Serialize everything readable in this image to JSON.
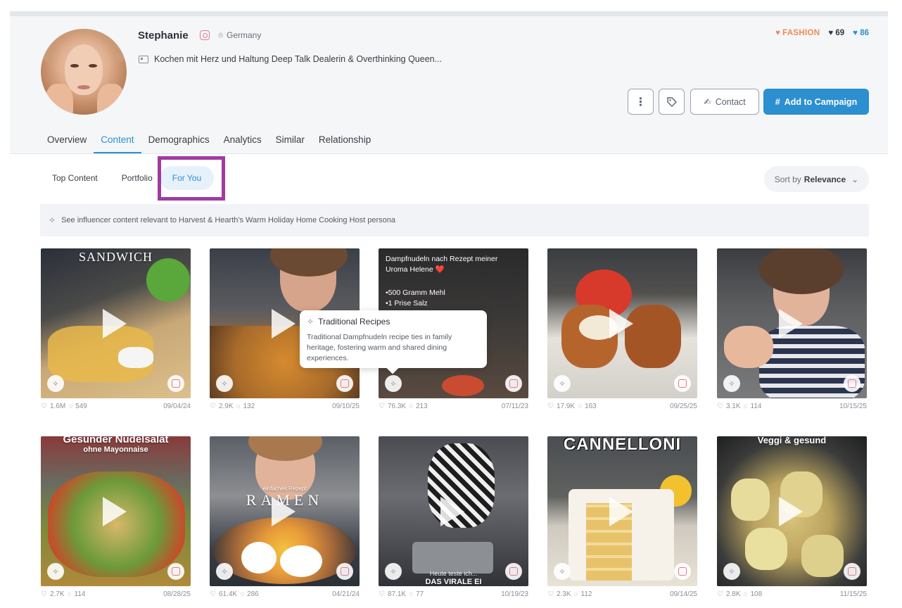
{
  "profile": {
    "name": "Stephanie",
    "country": "Germany",
    "bio": "Kochen mit Herz und Haltung Deep Talk Dealerin & Overthinking Queen...",
    "category": "FASHION",
    "score_a": "69",
    "score_b": "86"
  },
  "actions": {
    "contact": "Contact",
    "add_campaign": "Add to Campaign"
  },
  "tabs": [
    "Overview",
    "Content",
    "Demographics",
    "Analytics",
    "Similar",
    "Relationship"
  ],
  "subtabs": [
    "Top Content",
    "Portfolio",
    "For You"
  ],
  "sort": {
    "prefix": "Sort by",
    "value": "Relevance"
  },
  "info_text": "See influencer content relevant to Harvest & Hearth's Warm Holiday Home Cooking Host persona",
  "tooltip": {
    "title": "Traditional Recipes",
    "body": "Traditional Dampfnudeln recipe ties in family heritage, fostering warm and shared dining experiences."
  },
  "posts": [
    {
      "likes": "1.6M",
      "comments": "549",
      "date": "09/04/24",
      "caption": "SANDWICH"
    },
    {
      "likes": "2.9K",
      "comments": "132",
      "date": "09/10/25",
      "caption": ""
    },
    {
      "likes": "76.3K",
      "comments": "213",
      "date": "07/11/23",
      "caption": "Dampfnudeln nach Rezept meiner Uroma Helene ❤️",
      "caption2": "•500 Gramm Mehl",
      "caption3": "•1 Prise Salz"
    },
    {
      "likes": "17.9K",
      "comments": "163",
      "date": "09/25/25",
      "caption": ""
    },
    {
      "likes": "3.1K",
      "comments": "114",
      "date": "10/15/25",
      "caption": ""
    },
    {
      "likes": "2.7K",
      "comments": "114",
      "date": "08/28/25",
      "caption": "Gesunder Nudelsalat",
      "caption2": "ohne Mayonnaise"
    },
    {
      "likes": "61.4K",
      "comments": "286",
      "date": "04/21/24",
      "caption": "RAMEN",
      "caption2": "einfaches Rezept"
    },
    {
      "likes": "87.1K",
      "comments": "77",
      "date": "10/19/23",
      "caption": "Heute teste ich...",
      "caption2": "DAS VIRALE EI"
    },
    {
      "likes": "2.3K",
      "comments": "112",
      "date": "09/14/25",
      "caption": "CANNELLONI"
    },
    {
      "likes": "2.8K",
      "comments": "108",
      "date": "11/15/25",
      "caption": "Veggi & gesund"
    }
  ]
}
